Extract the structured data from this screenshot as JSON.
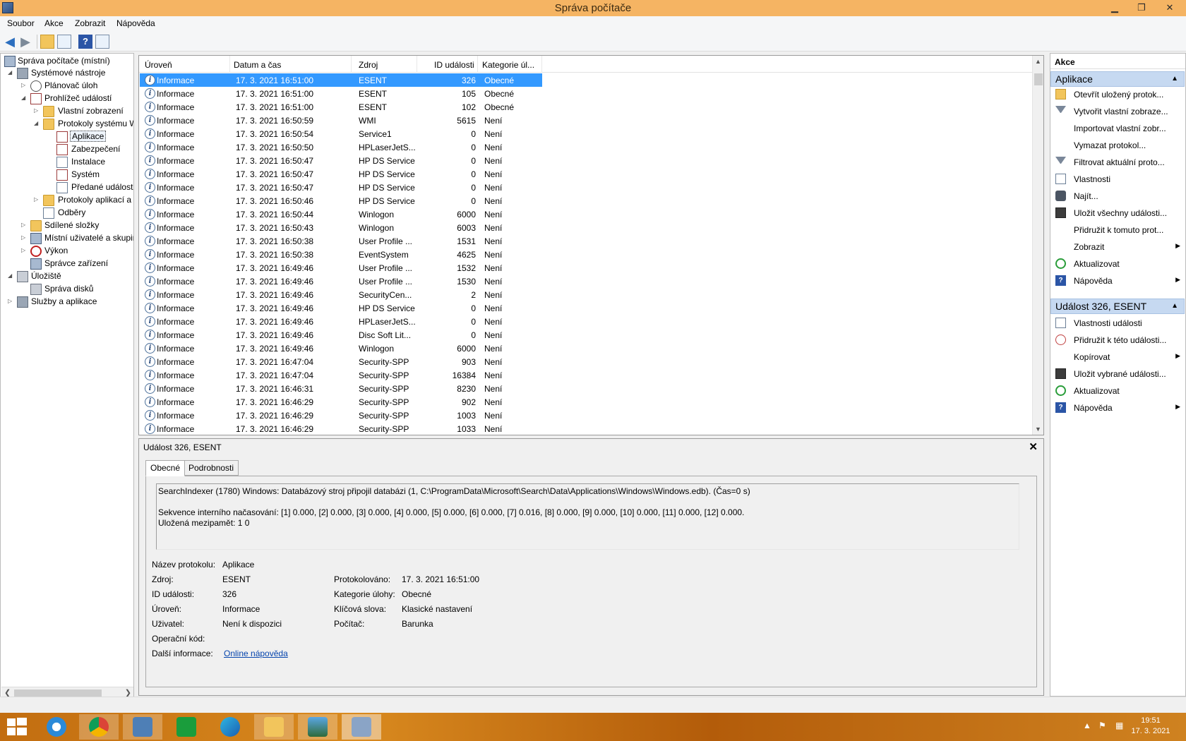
{
  "window": {
    "title": "Správa počítače"
  },
  "menu": [
    "Soubor",
    "Akce",
    "Zobrazit",
    "Nápověda"
  ],
  "tree": [
    {
      "label": "Správa počítače (místní)",
      "icon": "computer-management-icon",
      "level": 0
    },
    {
      "label": "Systémové nástroje",
      "icon": "system-tools-icon",
      "level": 1
    },
    {
      "label": "Plánovač úloh",
      "icon": "task-scheduler-icon",
      "level": 2
    },
    {
      "label": "Prohlížeč událostí",
      "icon": "event-viewer-icon",
      "level": 2
    },
    {
      "label": "Vlastní zobrazení",
      "icon": "folder-icon",
      "level": 3
    },
    {
      "label": "Protokoly systému W",
      "icon": "folder-icon",
      "level": 3
    },
    {
      "label": "Aplikace",
      "icon": "log-icon",
      "level": 4
    },
    {
      "label": "Zabezpečení",
      "icon": "log-icon",
      "level": 4
    },
    {
      "label": "Instalace",
      "icon": "log-icon",
      "level": 4
    },
    {
      "label": "Systém",
      "icon": "log-icon",
      "level": 4
    },
    {
      "label": "Předané události",
      "icon": "log-icon",
      "level": 4
    },
    {
      "label": "Protokoly aplikací a",
      "icon": "folder-icon",
      "level": 3
    },
    {
      "label": "Odběry",
      "icon": "subscriptions-icon",
      "level": 3
    },
    {
      "label": "Sdílené složky",
      "icon": "shared-folders-icon",
      "level": 2
    },
    {
      "label": "Místní uživatelé a skupir",
      "icon": "users-icon",
      "level": 2
    },
    {
      "label": "Výkon",
      "icon": "performance-icon",
      "level": 2
    },
    {
      "label": "Správce zařízení",
      "icon": "device-manager-icon",
      "level": 2
    },
    {
      "label": "Úložiště",
      "icon": "storage-icon",
      "level": 1
    },
    {
      "label": "Správa disků",
      "icon": "disk-management-icon",
      "level": 2
    },
    {
      "label": "Služby a aplikace",
      "icon": "services-icon",
      "level": 1
    }
  ],
  "events": {
    "columns": [
      "Úroveň",
      "Datum a čas",
      "Zdroj",
      "ID události",
      "Kategorie úl..."
    ],
    "rows": [
      [
        "Informace",
        "17. 3. 2021 16:51:00",
        "ESENT",
        "326",
        "Obecné"
      ],
      [
        "Informace",
        "17. 3. 2021 16:51:00",
        "ESENT",
        "105",
        "Obecné"
      ],
      [
        "Informace",
        "17. 3. 2021 16:51:00",
        "ESENT",
        "102",
        "Obecné"
      ],
      [
        "Informace",
        "17. 3. 2021 16:50:59",
        "WMI",
        "5615",
        "Není"
      ],
      [
        "Informace",
        "17. 3. 2021 16:50:54",
        "Service1",
        "0",
        "Není"
      ],
      [
        "Informace",
        "17. 3. 2021 16:50:50",
        "HPLaserJetS...",
        "0",
        "Není"
      ],
      [
        "Informace",
        "17. 3. 2021 16:50:47",
        "HP DS Service",
        "0",
        "Není"
      ],
      [
        "Informace",
        "17. 3. 2021 16:50:47",
        "HP DS Service",
        "0",
        "Není"
      ],
      [
        "Informace",
        "17. 3. 2021 16:50:47",
        "HP DS Service",
        "0",
        "Není"
      ],
      [
        "Informace",
        "17. 3. 2021 16:50:46",
        "HP DS Service",
        "0",
        "Není"
      ],
      [
        "Informace",
        "17. 3. 2021 16:50:44",
        "Winlogon",
        "6000",
        "Není"
      ],
      [
        "Informace",
        "17. 3. 2021 16:50:43",
        "Winlogon",
        "6003",
        "Není"
      ],
      [
        "Informace",
        "17. 3. 2021 16:50:38",
        "User Profile ...",
        "1531",
        "Není"
      ],
      [
        "Informace",
        "17. 3. 2021 16:50:38",
        "EventSystem",
        "4625",
        "Není"
      ],
      [
        "Informace",
        "17. 3. 2021 16:49:46",
        "User Profile ...",
        "1532",
        "Není"
      ],
      [
        "Informace",
        "17. 3. 2021 16:49:46",
        "User Profile ...",
        "1530",
        "Není"
      ],
      [
        "Informace",
        "17. 3. 2021 16:49:46",
        "SecurityCen...",
        "2",
        "Není"
      ],
      [
        "Informace",
        "17. 3. 2021 16:49:46",
        "HP DS Service",
        "0",
        "Není"
      ],
      [
        "Informace",
        "17. 3. 2021 16:49:46",
        "HPLaserJetS...",
        "0",
        "Není"
      ],
      [
        "Informace",
        "17. 3. 2021 16:49:46",
        "Disc Soft Lit...",
        "0",
        "Není"
      ],
      [
        "Informace",
        "17. 3. 2021 16:49:46",
        "Winlogon",
        "6000",
        "Není"
      ],
      [
        "Informace",
        "17. 3. 2021 16:47:04",
        "Security-SPP",
        "903",
        "Není"
      ],
      [
        "Informace",
        "17. 3. 2021 16:47:04",
        "Security-SPP",
        "16384",
        "Není"
      ],
      [
        "Informace",
        "17. 3. 2021 16:46:31",
        "Security-SPP",
        "8230",
        "Není"
      ],
      [
        "Informace",
        "17. 3. 2021 16:46:29",
        "Security-SPP",
        "902",
        "Není"
      ],
      [
        "Informace",
        "17. 3. 2021 16:46:29",
        "Security-SPP",
        "1003",
        "Není"
      ],
      [
        "Informace",
        "17. 3. 2021 16:46:29",
        "Security-SPP",
        "1033",
        "Není"
      ]
    ]
  },
  "detail": {
    "title": "Událost 326, ESENT",
    "tabs": [
      "Obecné",
      "Podrobnosti"
    ],
    "message": "SearchIndexer (1780) Windows: Databázový stroj připojil databázi (1, C:\\ProgramData\\Microsoft\\Search\\Data\\Applications\\Windows\\Windows.edb). (Čas=0 s)\n\nSekvence interního načasování: [1] 0.000, [2] 0.000, [3] 0.000, [4] 0.000, [5] 0.000, [6] 0.000, [7] 0.016, [8] 0.000, [9] 0.000, [10] 0.000, [11] 0.000, [12] 0.000.\nUložená mezipamět: 1 0",
    "labels": {
      "log_name": "Název protokolu:",
      "source": "Zdroj:",
      "event_id": "ID události:",
      "level": "Úroveň:",
      "user": "Uživatel:",
      "opcode": "Operační kód:",
      "more_info": "Další informace:",
      "logged": "Protokolováno:",
      "task_category": "Kategorie úlohy:",
      "keywords": "Klíčová slova:",
      "computer": "Počítač:"
    },
    "values": {
      "log_name": "Aplikace",
      "source": "ESENT",
      "event_id": "326",
      "level": "Informace",
      "user": "Není k dispozici",
      "opcode": "",
      "more_info": "Online nápověda",
      "logged": "17. 3. 2021 16:51:00",
      "task_category": "Obecné",
      "keywords": "Klasické nastavení",
      "computer": "Barunka"
    }
  },
  "actions": {
    "header": "Akce",
    "section1": "Aplikace",
    "items1": [
      {
        "label": "Otevřít uložený protok...",
        "icon": "open-icon"
      },
      {
        "label": "Vytvořit vlastní zobraze...",
        "icon": "filter-icon"
      },
      {
        "label": "Importovat vlastní zobr...",
        "icon": ""
      },
      {
        "label": "Vymazat protokol...",
        "icon": ""
      },
      {
        "label": "Filtrovat aktuální proto...",
        "icon": "filter-icon"
      },
      {
        "label": "Vlastnosti",
        "icon": "properties-icon"
      },
      {
        "label": "Najít...",
        "icon": "find-icon"
      },
      {
        "label": "Uložit všechny události...",
        "icon": "save-icon"
      },
      {
        "label": "Přidružit k tomuto prot...",
        "icon": ""
      },
      {
        "label": "Zobrazit",
        "icon": "",
        "submenu": true
      },
      {
        "label": "Aktualizovat",
        "icon": "refresh-icon"
      },
      {
        "label": "Nápověda",
        "icon": "help-icon",
        "submenu": true
      }
    ],
    "section2": "Událost 326, ESENT",
    "items2": [
      {
        "label": "Vlastnosti události",
        "icon": "properties-icon"
      },
      {
        "label": "Přidružit k této události...",
        "icon": "attach-icon"
      },
      {
        "label": "Kopírovat",
        "icon": "",
        "submenu": true
      },
      {
        "label": "Uložit vybrané události...",
        "icon": "save-icon"
      },
      {
        "label": "Aktualizovat",
        "icon": "refresh-icon"
      },
      {
        "label": "Nápověda",
        "icon": "help-icon",
        "submenu": true
      }
    ]
  },
  "taskbar": {
    "apps": [
      "start-icon",
      "internet-explorer-icon",
      "chrome-icon",
      "control-panel-icon",
      "store-icon",
      "edge-icon",
      "file-explorer-icon",
      "photos-icon",
      "computer-management-icon"
    ],
    "clock_time": "19:51",
    "clock_date": "17. 3. 2021"
  }
}
